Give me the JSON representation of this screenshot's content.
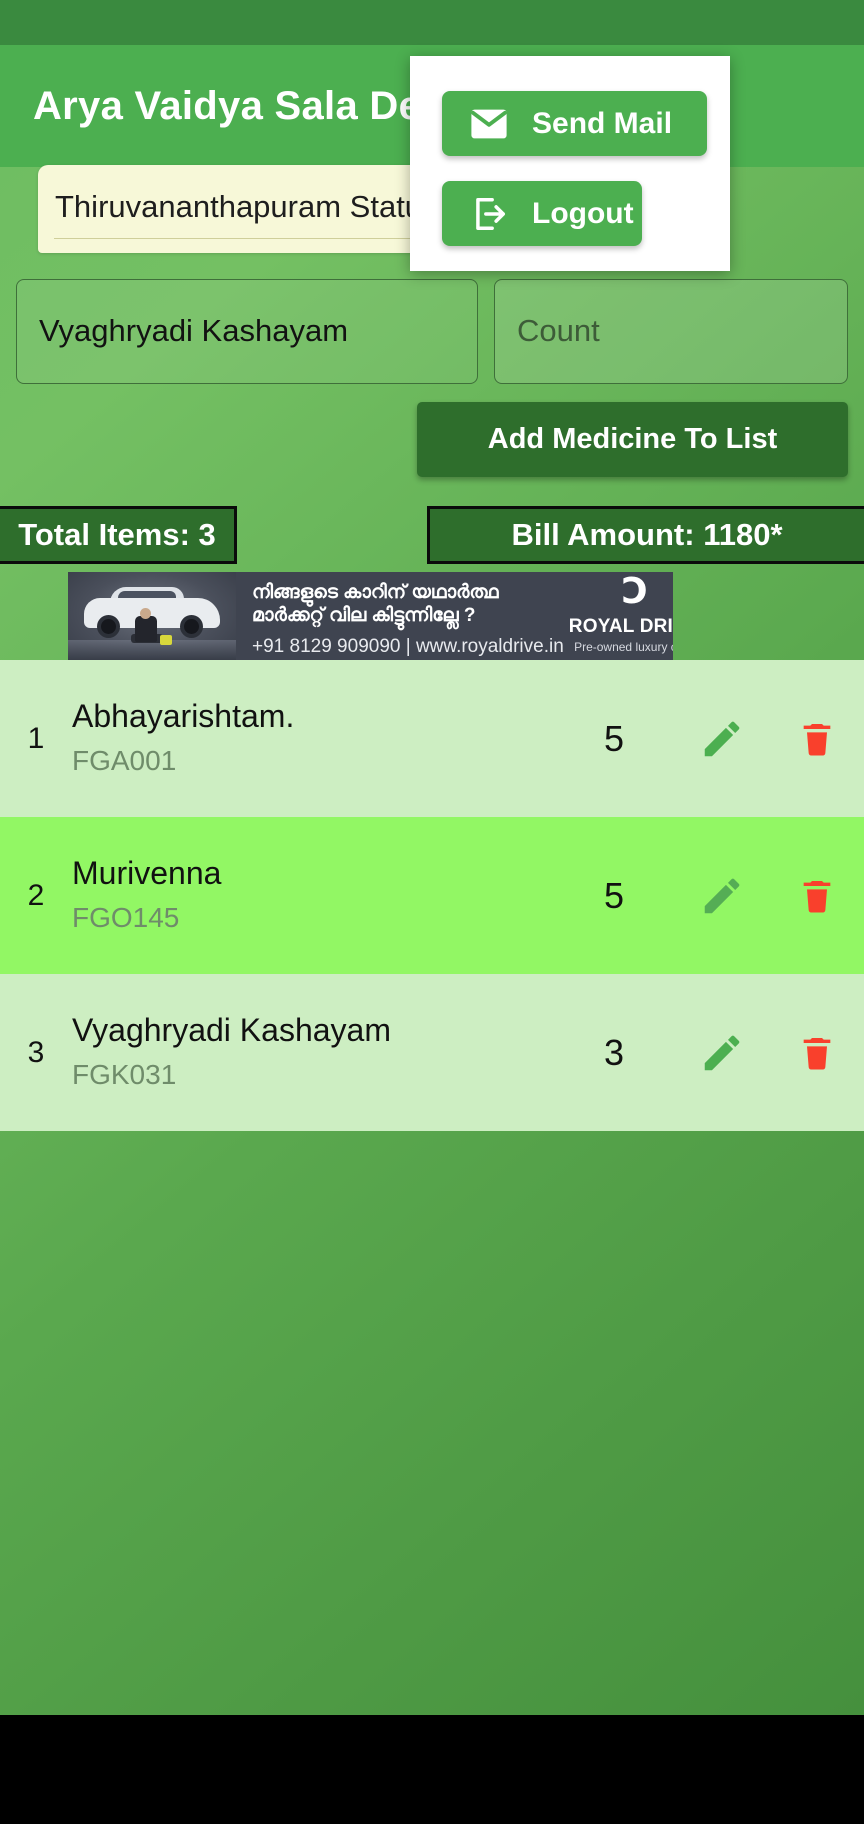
{
  "app": {
    "title": "Arya Vaidya Sala Dealer"
  },
  "menu": {
    "items": [
      {
        "label": "Send Mail",
        "icon": "mail-icon"
      },
      {
        "label": "Logout",
        "icon": "logout-icon"
      }
    ]
  },
  "form": {
    "status_field_value": "Thiruvananthapuram Statue",
    "medicine_value": "Vyaghryadi Kashayam",
    "count_placeholder": "Count",
    "add_button_label": "Add Medicine To List"
  },
  "summary": {
    "total_items_label": "Total Items: 3",
    "bill_amount_label": "Bill Amount: 1180*"
  },
  "ad": {
    "headline_line1": "നിങ്ങളുടെ കാറിന് യഥാർത്ഥ",
    "headline_line2": "മാർക്കറ്റ് വില കിട്ടുന്നില്ലേ ?",
    "contact": "+91 8129 909090 | www.royaldrive.in",
    "logo_mark": "Ɔ",
    "brand": "ROYAL DRIVE",
    "tagline": "Pre-owned luxury cars"
  },
  "list": {
    "rows": [
      {
        "index": "1",
        "name": "Abhayarishtam.",
        "code": "FGA001",
        "qty": "5"
      },
      {
        "index": "2",
        "name": "Murivenna",
        "code": "FGO145",
        "qty": "5"
      },
      {
        "index": "3",
        "name": "Vyaghryadi Kashayam",
        "code": "FGK031",
        "qty": "3"
      }
    ]
  },
  "colors": {
    "app_bar": "#4caf50",
    "status_bar": "#3a8a3f",
    "accent_dark": "#2e6e2c",
    "delete": "#f9402c",
    "edit": "#4caf50"
  }
}
